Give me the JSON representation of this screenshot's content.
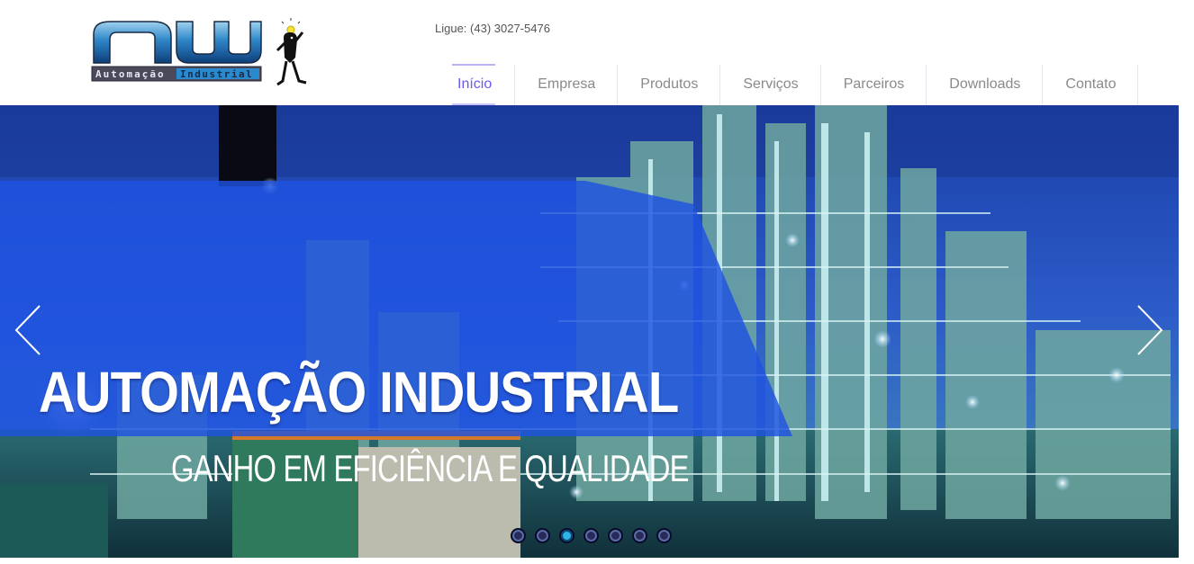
{
  "header": {
    "phone": "Ligue: (43) 3027-5476",
    "logo": {
      "brand": "nw",
      "tagline": "Automação Industrial"
    }
  },
  "nav": {
    "items": [
      {
        "label": "Início",
        "active": true
      },
      {
        "label": "Empresa",
        "active": false
      },
      {
        "label": "Produtos",
        "active": false
      },
      {
        "label": "Serviços",
        "active": false
      },
      {
        "label": "Parceiros",
        "active": false
      },
      {
        "label": "Downloads",
        "active": false
      },
      {
        "label": "Contato",
        "active": false
      }
    ]
  },
  "slider": {
    "headline": "AUTOMAÇÃO INDUSTRIAL",
    "subline": "GANHO EM EFICIÊNCIA E QUALIDADE",
    "slide_count": 7,
    "active_slide": 3,
    "prev_icon": "chevron-left-icon",
    "next_icon": "chevron-right-icon"
  },
  "colors": {
    "nav_active": "#6a5af0",
    "nav_text": "#8a8a8a",
    "banner_blue": "#1f52e0",
    "dot_active": "#2fb6e8"
  }
}
